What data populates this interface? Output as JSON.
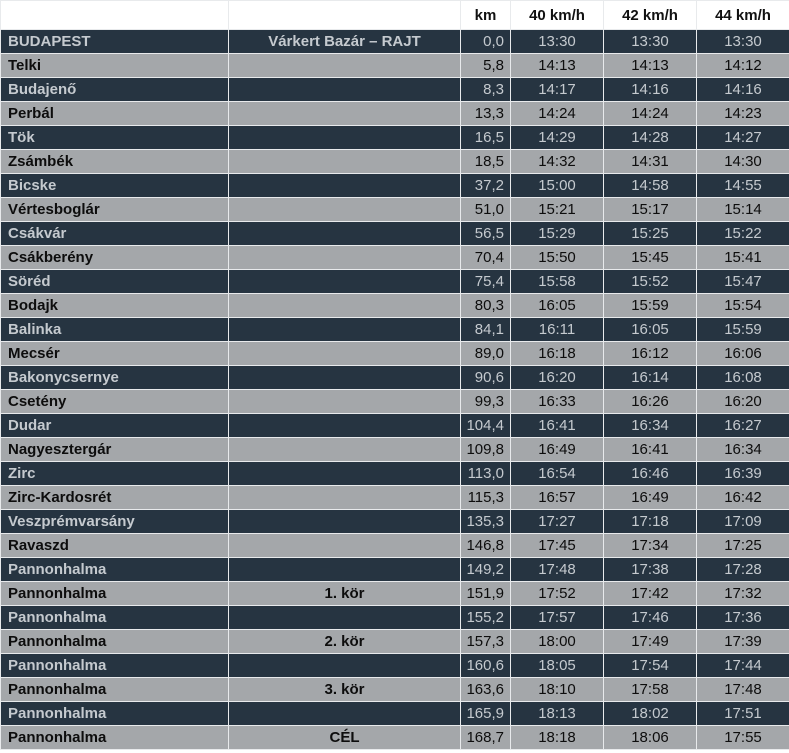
{
  "header": {
    "name": "",
    "note": "",
    "km": "km",
    "speed_40": "40 km/h",
    "speed_42": "42 km/h",
    "speed_44": "44 km/h"
  },
  "rows": [
    {
      "name": "BUDAPEST",
      "note": "Várkert Bazár – RAJT",
      "km": "0,0",
      "t40": "13:30",
      "t42": "13:30",
      "t44": "13:30"
    },
    {
      "name": "Telki",
      "note": "",
      "km": "5,8",
      "t40": "14:13",
      "t42": "14:13",
      "t44": "14:12"
    },
    {
      "name": "Budajenő",
      "note": "",
      "km": "8,3",
      "t40": "14:17",
      "t42": "14:16",
      "t44": "14:16"
    },
    {
      "name": "Perbál",
      "note": "",
      "km": "13,3",
      "t40": "14:24",
      "t42": "14:24",
      "t44": "14:23"
    },
    {
      "name": "Tök",
      "note": "",
      "km": "16,5",
      "t40": "14:29",
      "t42": "14:28",
      "t44": "14:27"
    },
    {
      "name": "Zsámbék",
      "note": "",
      "km": "18,5",
      "t40": "14:32",
      "t42": "14:31",
      "t44": "14:30"
    },
    {
      "name": "Bicske",
      "note": "",
      "km": "37,2",
      "t40": "15:00",
      "t42": "14:58",
      "t44": "14:55"
    },
    {
      "name": "Vértesboglár",
      "note": "",
      "km": "51,0",
      "t40": "15:21",
      "t42": "15:17",
      "t44": "15:14"
    },
    {
      "name": "Csákvár",
      "note": "",
      "km": "56,5",
      "t40": "15:29",
      "t42": "15:25",
      "t44": "15:22"
    },
    {
      "name": "Csákberény",
      "note": "",
      "km": "70,4",
      "t40": "15:50",
      "t42": "15:45",
      "t44": "15:41"
    },
    {
      "name": "Söréd",
      "note": "",
      "km": "75,4",
      "t40": "15:58",
      "t42": "15:52",
      "t44": "15:47"
    },
    {
      "name": "Bodajk",
      "note": "",
      "km": "80,3",
      "t40": "16:05",
      "t42": "15:59",
      "t44": "15:54"
    },
    {
      "name": "Balinka",
      "note": "",
      "km": "84,1",
      "t40": "16:11",
      "t42": "16:05",
      "t44": "15:59"
    },
    {
      "name": "Mecsér",
      "note": "",
      "km": "89,0",
      "t40": "16:18",
      "t42": "16:12",
      "t44": "16:06"
    },
    {
      "name": "Bakonycsernye",
      "note": "",
      "km": "90,6",
      "t40": "16:20",
      "t42": "16:14",
      "t44": "16:08"
    },
    {
      "name": "Csetény",
      "note": "",
      "km": "99,3",
      "t40": "16:33",
      "t42": "16:26",
      "t44": "16:20"
    },
    {
      "name": "Dudar",
      "note": "",
      "km": "104,4",
      "t40": "16:41",
      "t42": "16:34",
      "t44": "16:27"
    },
    {
      "name": "Nagyesztergár",
      "note": "",
      "km": "109,8",
      "t40": "16:49",
      "t42": "16:41",
      "t44": "16:34"
    },
    {
      "name": "Zirc",
      "note": "",
      "km": "113,0",
      "t40": "16:54",
      "t42": "16:46",
      "t44": "16:39"
    },
    {
      "name": "Zirc-Kardosrét",
      "note": "",
      "km": "115,3",
      "t40": "16:57",
      "t42": "16:49",
      "t44": "16:42"
    },
    {
      "name": "Veszprémvarsány",
      "note": "",
      "km": "135,3",
      "t40": "17:27",
      "t42": "17:18",
      "t44": "17:09"
    },
    {
      "name": "Ravaszd",
      "note": "",
      "km": "146,8",
      "t40": "17:45",
      "t42": "17:34",
      "t44": "17:25"
    },
    {
      "name": "Pannonhalma",
      "note": "",
      "km": "149,2",
      "t40": "17:48",
      "t42": "17:38",
      "t44": "17:28"
    },
    {
      "name": "Pannonhalma",
      "note": "1. kör",
      "km": "151,9",
      "t40": "17:52",
      "t42": "17:42",
      "t44": "17:32"
    },
    {
      "name": "Pannonhalma",
      "note": "",
      "km": "155,2",
      "t40": "17:57",
      "t42": "17:46",
      "t44": "17:36"
    },
    {
      "name": "Pannonhalma",
      "note": "2. kör",
      "km": "157,3",
      "t40": "18:00",
      "t42": "17:49",
      "t44": "17:39"
    },
    {
      "name": "Pannonhalma",
      "note": "",
      "km": "160,6",
      "t40": "18:05",
      "t42": "17:54",
      "t44": "17:44"
    },
    {
      "name": "Pannonhalma",
      "note": "3. kör",
      "km": "163,6",
      "t40": "18:10",
      "t42": "17:58",
      "t44": "17:48"
    },
    {
      "name": "Pannonhalma",
      "note": "",
      "km": "165,9",
      "t40": "18:13",
      "t42": "18:02",
      "t44": "17:51"
    },
    {
      "name": "Pannonhalma",
      "note": "CÉL",
      "km": "168,7",
      "t40": "18:18",
      "t42": "18:06",
      "t44": "17:55"
    }
  ]
}
